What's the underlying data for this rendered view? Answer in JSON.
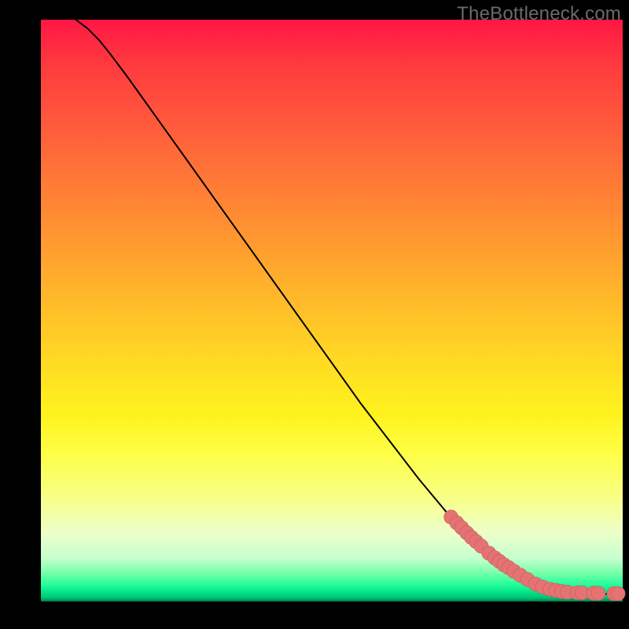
{
  "watermark_text": "TheBottleneck.com",
  "chart_data": {
    "type": "line",
    "title": "",
    "xlabel": "",
    "ylabel": "",
    "xlim": [
      0,
      100
    ],
    "ylim": [
      0,
      100
    ],
    "grid": false,
    "legend": false,
    "series": [
      {
        "name": "bottleneck-curve",
        "x": [
          6,
          8,
          10,
          12,
          15,
          20,
          25,
          30,
          35,
          40,
          45,
          50,
          55,
          60,
          65,
          70,
          75,
          80,
          83,
          85,
          87,
          88,
          90,
          92,
          94,
          96,
          98,
          100
        ],
        "y": [
          100,
          98.5,
          96.5,
          94.0,
          90.0,
          83.0,
          76.0,
          69.0,
          62.0,
          55.0,
          48.0,
          41.0,
          34.0,
          27.5,
          21.0,
          15.0,
          10.0,
          6.0,
          4.0,
          2.8,
          2.0,
          1.7,
          1.5,
          1.4,
          1.35,
          1.3,
          1.3,
          1.3
        ]
      }
    ],
    "markers": {
      "name": "highlight-points",
      "x": [
        70.5,
        71.5,
        72.3,
        73.2,
        74.0,
        74.8,
        75.7,
        77.0,
        78.0,
        78.8,
        79.6,
        80.4,
        81.3,
        82.4,
        83.6,
        85.0,
        86.2,
        87.5,
        88.5,
        89.5,
        90.5,
        92.2,
        93.0,
        95.0,
        95.8,
        98.5,
        99.2
      ],
      "y": [
        14.5,
        13.5,
        12.7,
        11.8,
        11.0,
        10.3,
        9.5,
        8.3,
        7.5,
        6.9,
        6.3,
        5.8,
        5.2,
        4.5,
        3.8,
        3.0,
        2.5,
        2.1,
        1.9,
        1.7,
        1.6,
        1.5,
        1.5,
        1.4,
        1.4,
        1.35,
        1.35
      ]
    },
    "gradient_stops": [
      {
        "pos": 0.0,
        "color": "#ff1744"
      },
      {
        "pos": 0.3,
        "color": "#ff8a2a"
      },
      {
        "pos": 0.6,
        "color": "#ffe81e"
      },
      {
        "pos": 0.8,
        "color": "#fbff60"
      },
      {
        "pos": 0.92,
        "color": "#c5ffcd"
      },
      {
        "pos": 0.97,
        "color": "#24ff98"
      },
      {
        "pos": 1.0,
        "color": "#007a4a"
      }
    ]
  }
}
